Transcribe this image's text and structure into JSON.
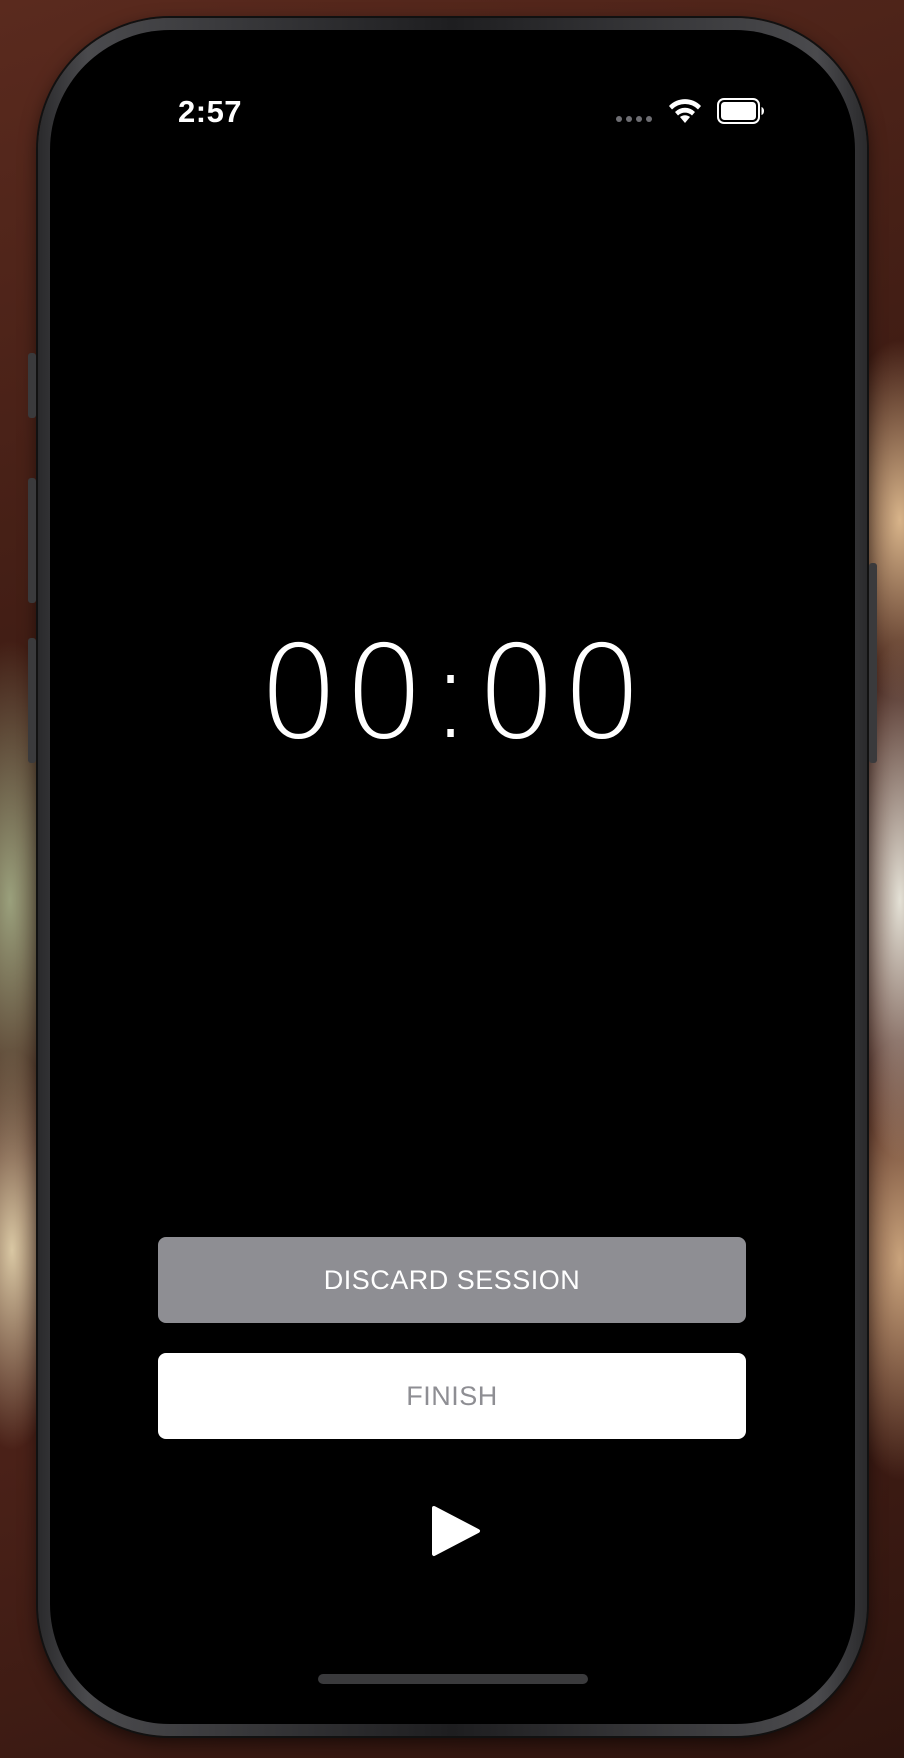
{
  "status_bar": {
    "time": "2:57"
  },
  "timer": {
    "display": "00:00"
  },
  "actions": {
    "discard_label": "DISCARD SESSION",
    "finish_label": "FINISH"
  },
  "icons": {
    "signal": "cellular-signal-icon",
    "wifi": "wifi-icon",
    "battery": "battery-icon",
    "play": "play-icon"
  },
  "colors": {
    "screen_bg": "#000000",
    "discard_bg": "#8e8e93",
    "discard_text": "#ffffff",
    "finish_bg": "#ffffff",
    "finish_text": "#8e8e93",
    "timer_text": "#ffffff"
  }
}
